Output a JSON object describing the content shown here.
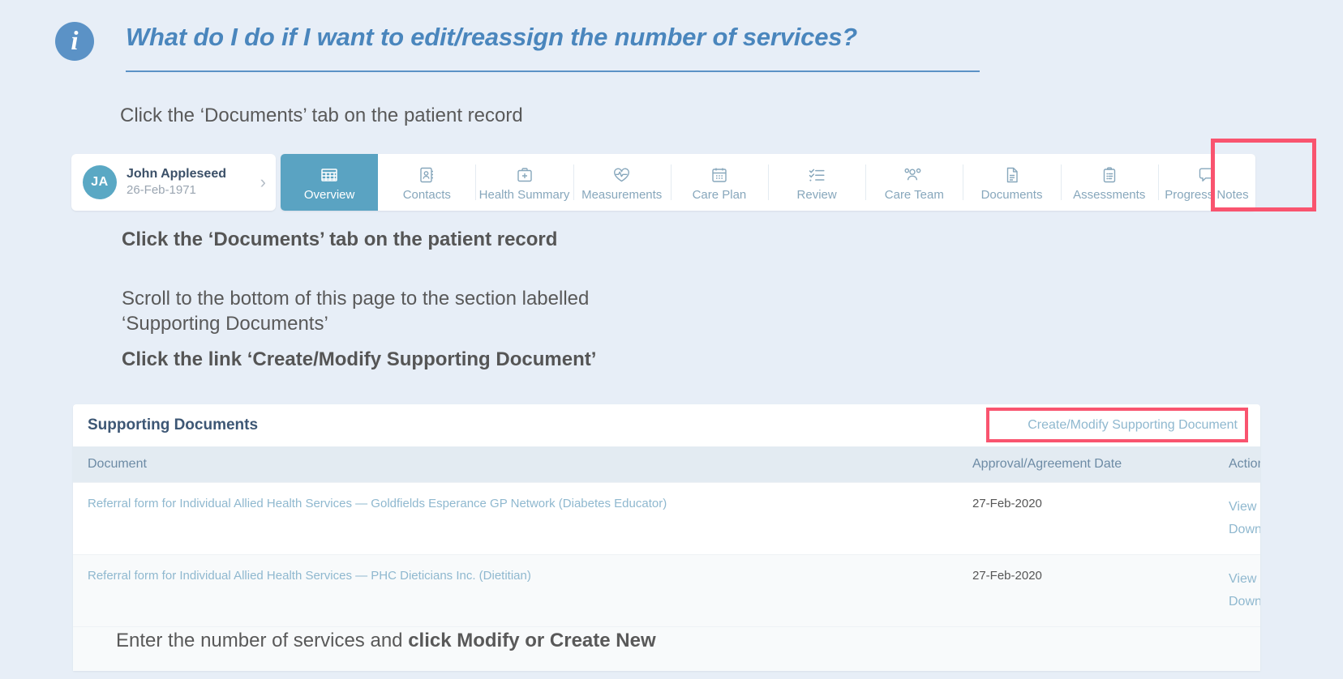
{
  "header": {
    "icon": "info-icon",
    "title": "What do I do if I want to edit/reassign the number of services?",
    "accent_color": "#4a86bd"
  },
  "instructions": {
    "step1": "Click the ‘Documents’ tab on the patient record",
    "step2": "Click the ‘Documents’ tab on the patient record",
    "step3": "Scroll to the bottom of this page to the section labelled\n‘Supporting Documents’",
    "step4": "Click the link ‘Create/Modify Supporting Document’",
    "step5_regular": "Enter the number of services and ",
    "step5_bold": "click Modify or Create New"
  },
  "patient_card": {
    "initials": "JA",
    "name": "John Appleseed",
    "dob": "26-Feb-1971",
    "chevron": "›"
  },
  "tabs": [
    {
      "label": "Overview",
      "icon": "grid-icon",
      "active": true
    },
    {
      "label": "Contacts",
      "icon": "address-book-icon",
      "active": false
    },
    {
      "label": "Health Summary",
      "icon": "medical-bag-icon",
      "active": false
    },
    {
      "label": "Measurements",
      "icon": "heart-pulse-icon",
      "active": false
    },
    {
      "label": "Care Plan",
      "icon": "calendar-icon",
      "active": false
    },
    {
      "label": "Review",
      "icon": "checklist-icon",
      "active": false
    },
    {
      "label": "Care Team",
      "icon": "people-icon",
      "active": false
    },
    {
      "label": "Documents",
      "icon": "document-icon",
      "active": false,
      "highlighted": true
    },
    {
      "label": "Assessments",
      "icon": "clipboard-icon",
      "active": false
    },
    {
      "label": "Progress Notes",
      "icon": "speech-bubble-icon",
      "active": false
    }
  ],
  "documents_panel": {
    "title": "Supporting Documents",
    "create_link": "Create/Modify Supporting Document",
    "columns": [
      "Document",
      "Approval/Agreement Date",
      "Actions"
    ],
    "rows": [
      {
        "document": "Referral form for Individual Allied Health Services — Goldfields Esperance GP Network (Diabetes Educator)",
        "date": "27-Feb-2020",
        "actions": [
          "View",
          "Download"
        ]
      },
      {
        "document": "Referral form for Individual Allied Health Services — PHC Dieticians Inc. (Dietitian)",
        "date": "27-Feb-2020",
        "actions": [
          "View",
          "Download"
        ]
      }
    ]
  },
  "highlight_color": "#f9546f"
}
